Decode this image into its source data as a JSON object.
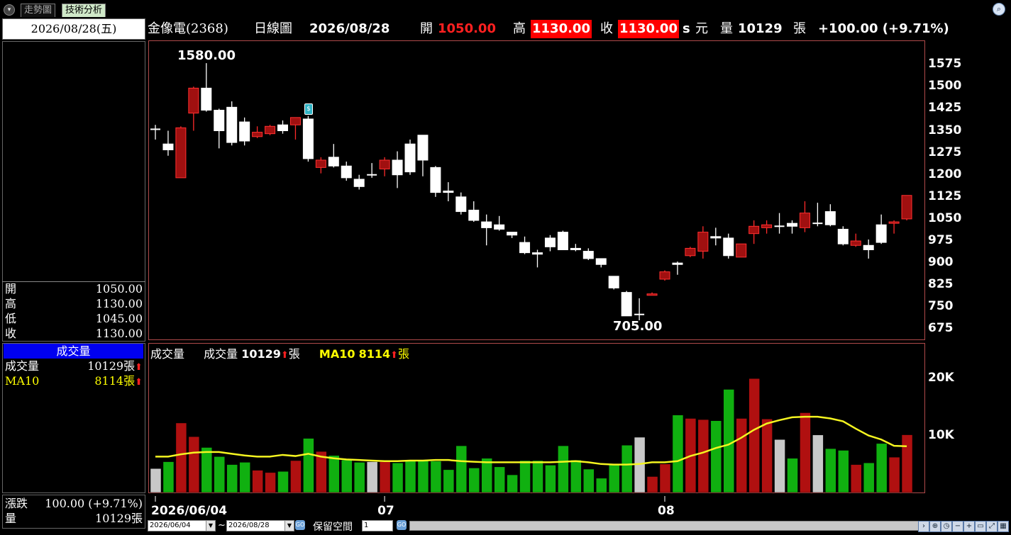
{
  "tabs": [
    {
      "label": "走勢圖"
    },
    {
      "label": "技術分析"
    }
  ],
  "left": {
    "date": "2026/08/28(五)",
    "ohlc": [
      {
        "label": "開",
        "value": "1050.00"
      },
      {
        "label": "高",
        "value": "1130.00"
      },
      {
        "label": "低",
        "value": "1045.00"
      },
      {
        "label": "收",
        "value": "1130.00"
      }
    ],
    "vol_header": "成交量",
    "vol_label": "成交量",
    "vol_value": "10129張",
    "ma_label": "MA10",
    "ma_value": "8114張",
    "change_label": "漲跌",
    "change_value": "100.00 (+9.71%)",
    "qty_label": "量",
    "qty_value": "10129張"
  },
  "header": {
    "stock": "金像電(2368)",
    "period": "日線圖",
    "date": "2026/08/28",
    "open_label": "開",
    "open": "1050.00",
    "high_label": "高",
    "high": "1130.00",
    "close_label": "收",
    "close": "1130.00",
    "suffix": "s",
    "unit": "元",
    "vol_label": "量",
    "vol": "10129",
    "vol_unit": "張",
    "change": "+100.00 (+9.71%)"
  },
  "volume_title": {
    "label": "成交量",
    "vol_label": "成交量",
    "vol_value": "10129",
    "unit": "張",
    "ma_label": "MA10",
    "ma_value": "8114"
  },
  "chart_data": {
    "type": "candlestick",
    "price_axis_ticks": [
      "1575",
      "1500",
      "1425",
      "1350",
      "1275",
      "1200",
      "1125",
      "1050",
      "975",
      "900",
      "825",
      "750",
      "675"
    ],
    "price_range": [
      640,
      1655
    ],
    "high_annotation": "1580.00",
    "low_annotation": "705.00",
    "volume_axis_ticks": [
      "20K",
      "10K"
    ],
    "volume_range": [
      0,
      26000
    ],
    "x_labels": [
      {
        "label": "2026/06/04",
        "index": 0
      },
      {
        "label": "07",
        "index": 18
      },
      {
        "label": "08",
        "index": 40
      }
    ],
    "candles": [
      [
        1355,
        1370,
        1320,
        1355,
        4200
      ],
      [
        1305,
        1350,
        1265,
        1285,
        5400
      ],
      [
        1190,
        1365,
        1190,
        1360,
        12200
      ],
      [
        1410,
        1500,
        1350,
        1495,
        9800
      ],
      [
        1495,
        1580,
        1415,
        1420,
        7900
      ],
      [
        1420,
        1425,
        1290,
        1350,
        6300
      ],
      [
        1430,
        1450,
        1300,
        1310,
        4900
      ],
      [
        1380,
        1395,
        1300,
        1315,
        5300
      ],
      [
        1330,
        1365,
        1325,
        1345,
        3900
      ],
      [
        1340,
        1370,
        1335,
        1365,
        3500
      ],
      [
        1370,
        1385,
        1340,
        1350,
        3700
      ],
      [
        1370,
        1395,
        1320,
        1395,
        5600
      ],
      [
        1390,
        1400,
        1245,
        1255,
        9500
      ],
      [
        1225,
        1260,
        1205,
        1250,
        7200
      ],
      [
        1260,
        1305,
        1225,
        1230,
        6500
      ],
      [
        1230,
        1245,
        1180,
        1190,
        5700
      ],
      [
        1185,
        1200,
        1150,
        1160,
        5300
      ],
      [
        1200,
        1240,
        1190,
        1200,
        5400
      ],
      [
        1220,
        1260,
        1195,
        1250,
        5400
      ],
      [
        1250,
        1280,
        1155,
        1200,
        5200
      ],
      [
        1305,
        1320,
        1200,
        1210,
        5700
      ],
      [
        1335,
        1335,
        1195,
        1250,
        5700
      ],
      [
        1225,
        1230,
        1125,
        1140,
        5500
      ],
      [
        1145,
        1175,
        1110,
        1140,
        4000
      ],
      [
        1125,
        1140,
        1065,
        1075,
        8200
      ],
      [
        1080,
        1110,
        1040,
        1045,
        4300
      ],
      [
        1040,
        1065,
        960,
        1020,
        6000
      ],
      [
        1030,
        1060,
        1010,
        1015,
        4500
      ],
      [
        1005,
        1005,
        985,
        995,
        3100
      ],
      [
        970,
        990,
        930,
        935,
        5600
      ],
      [
        935,
        945,
        885,
        930,
        5600
      ],
      [
        985,
        995,
        940,
        955,
        4800
      ],
      [
        1005,
        1010,
        945,
        945,
        8200
      ],
      [
        950,
        965,
        940,
        945,
        5700
      ],
      [
        940,
        950,
        910,
        915,
        4100
      ],
      [
        915,
        915,
        885,
        895,
        2500
      ],
      [
        855,
        855,
        810,
        815,
        5000
      ],
      [
        800,
        805,
        720,
        720,
        8300
      ],
      [
        725,
        780,
        705,
        725,
        9700
      ],
      [
        790,
        800,
        790,
        795,
        2800
      ],
      [
        845,
        875,
        840,
        870,
        5000
      ],
      [
        900,
        905,
        860,
        895,
        13600
      ],
      [
        925,
        955,
        920,
        950,
        13000
      ],
      [
        940,
        1025,
        915,
        1005,
        12800
      ],
      [
        990,
        1020,
        960,
        985,
        12600
      ],
      [
        985,
        1000,
        915,
        925,
        18100
      ],
      [
        920,
        965,
        920,
        965,
        13000
      ],
      [
        1000,
        1045,
        965,
        1025,
        20000
      ],
      [
        1020,
        1045,
        1000,
        1030,
        12900
      ],
      [
        1025,
        1070,
        1000,
        1025,
        9300
      ],
      [
        1035,
        1045,
        1000,
        1025,
        6000
      ],
      [
        1020,
        1110,
        1005,
        1070,
        14000
      ],
      [
        1035,
        1105,
        1025,
        1035,
        10100
      ],
      [
        1075,
        1100,
        1025,
        1030,
        7700
      ],
      [
        1015,
        1025,
        960,
        965,
        7400
      ],
      [
        960,
        1000,
        955,
        975,
        4900
      ],
      [
        960,
        980,
        915,
        945,
        5200
      ],
      [
        1030,
        1065,
        965,
        970,
        8600
      ],
      [
        1035,
        1045,
        1000,
        1040,
        6200
      ],
      [
        1050,
        1130,
        1045,
        1130,
        10129
      ]
    ],
    "ma10": [
      6300,
      6300,
      6700,
      7000,
      7100,
      7100,
      6800,
      6500,
      6300,
      6300,
      6600,
      6400,
      6800,
      6300,
      6000,
      5800,
      5700,
      5600,
      5500,
      5500,
      5600,
      5600,
      5700,
      5700,
      5500,
      5400,
      5300,
      5300,
      5300,
      5300,
      5300,
      5300,
      5400,
      5500,
      5300,
      5000,
      4900,
      4900,
      5000,
      5300,
      5300,
      5500,
      6400,
      7000,
      7800,
      8400,
      9600,
      11000,
      12100,
      12700,
      13200,
      13300,
      13300,
      13000,
      12500,
      11200,
      10000,
      9300,
      8200,
      8114
    ]
  }
}
